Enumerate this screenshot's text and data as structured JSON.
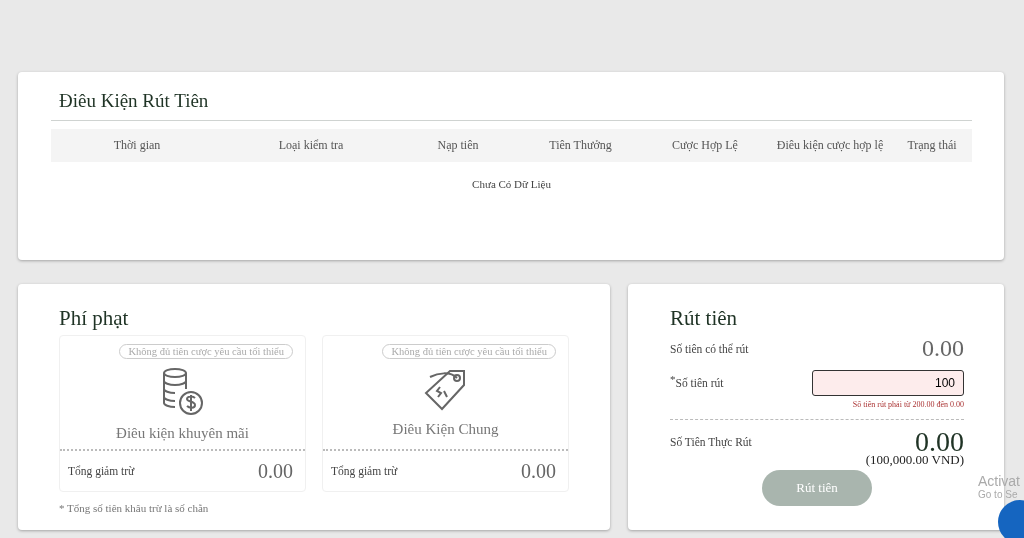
{
  "conditions": {
    "title": "Điêu Kiện Rút Tiên",
    "columns": [
      "Thời gian",
      "Loại kiểm tra",
      "Nạp tiên",
      "Tiên Thưởng",
      "Cược Hợp Lệ",
      "Điêu kiện cược hợp lệ",
      "Trạng thái"
    ],
    "empty_text": "Chưa Có Dữ Liệu"
  },
  "penalty": {
    "title": "Phí phạt",
    "cards": [
      {
        "kind": "coins",
        "tag": "Không đủ tiên cược yêu cầu tối thiểu",
        "name": "Điêu kiện khuyên mãi",
        "total_label": "Tổng giảm trừ",
        "total": "0.00"
      },
      {
        "kind": "tag",
        "tag": "Không đủ tiên cược yêu cầu tối thiểu",
        "name": "Điêu Kiện Chung",
        "total_label": "Tổng giảm trừ",
        "total": "0.00"
      }
    ],
    "note": "* Tổng số tiên khâu trừ là số chẵn"
  },
  "withdraw": {
    "title": "Rút tiên",
    "available_label": "Số tiên có thể rút",
    "available": "0.00",
    "required_mark": "*",
    "amount_label": "Số tiên rút",
    "amount_value": "100",
    "error": "Số tiên rút phải từ 200.00 đến 0.00",
    "actual_label": "Số Tiên Thực Rút",
    "actual": "0.00",
    "actual_vnd": "(100,000.00 VND)",
    "button": {
      "label": "Rút tiên",
      "disabled": true
    }
  },
  "overlay": {
    "line_1": "Activat",
    "line_2": "Go to Se"
  }
}
